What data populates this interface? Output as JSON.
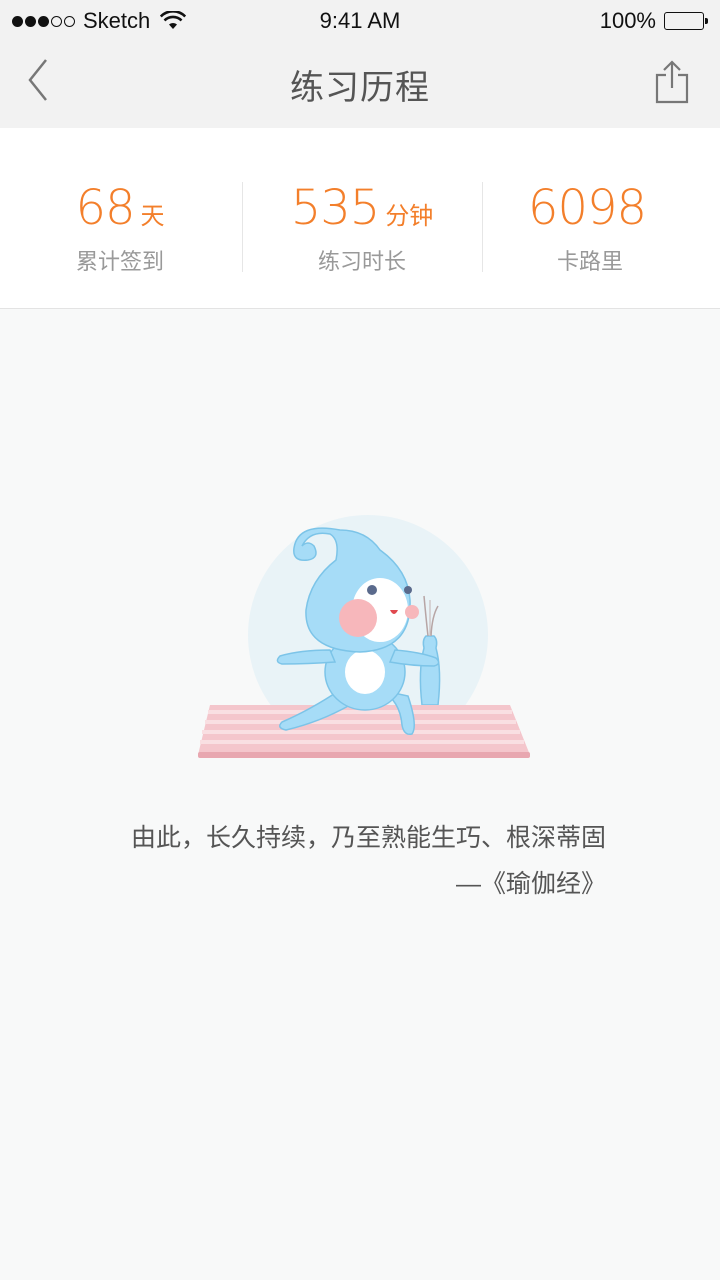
{
  "status_bar": {
    "carrier": "Sketch",
    "time": "9:41 AM",
    "battery": "100%"
  },
  "nav": {
    "title": "练习历程",
    "back_icon": "chevron-left-icon",
    "share_icon": "share-icon"
  },
  "stats": [
    {
      "value": "68",
      "unit": "天",
      "label": "累计签到"
    },
    {
      "value": "535",
      "unit": "分钟",
      "label": "练习时长"
    },
    {
      "value": "6098",
      "unit": "",
      "label": "卡路里"
    }
  ],
  "quote": {
    "text": "由此，长久持续，乃至熟能生巧、根深蒂固",
    "source": "—《瑜伽经》"
  },
  "colors": {
    "accent": "#f37f2b",
    "mascot": "#a6dcf7",
    "mat": "#f4c6cc",
    "background": "#f8f9f9"
  }
}
